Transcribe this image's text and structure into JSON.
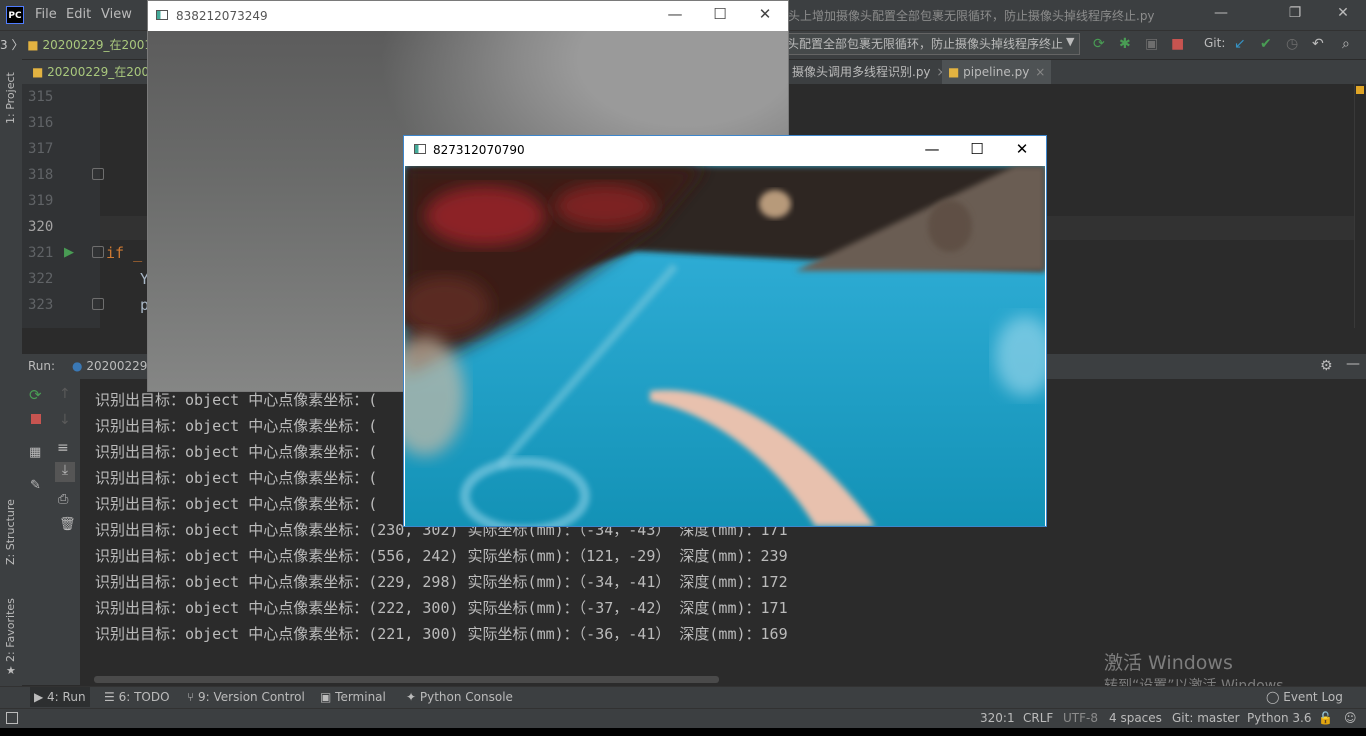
{
  "ide": {
    "logo": "PC",
    "menu": [
      "File",
      "Edit",
      "View"
    ],
    "title_fragment": "头上增加摄像头配置全部包裹无限循环，防止摄像头掉线程序终止.py",
    "minimize": "—",
    "maximize": "❐",
    "close": "✕"
  },
  "toolbar": {
    "project_crumb_left": "3 〉",
    "project_crumb": "20200229_在20010",
    "run_config": "头配置全部包裹无限循环，防止摄像头掉线程序终止",
    "git_label": "Git:"
  },
  "tabs": [
    {
      "label": "20200229_在200"
    },
    {
      "label": "摄像头调用多线程识别.py"
    },
    {
      "label": "pipeline.py"
    }
  ],
  "side_tabs": {
    "project": "1: Project",
    "structure": "Z: Structure",
    "favorites": "2: Favorites"
  },
  "editor": {
    "line_numbers": [
      "315",
      "316",
      "317",
      "318",
      "319",
      "320",
      "321",
      "322",
      "323"
    ],
    "code_if": "if _",
    "code_y": "Y",
    "code_p": "p"
  },
  "run": {
    "label": "Run:",
    "config": "20200229"
  },
  "console_lines": [
    "识别出目标：object 中心点像素坐标：(",
    "识别出目标：object 中心点像素坐标：(",
    "识别出目标：object 中心点像素坐标：(",
    "识别出目标：object 中心点像素坐标：(",
    "识别出目标：object 中心点像素坐标：(",
    "识别出目标：object 中心点像素坐标：(230, 302) 实际坐标(mm)：（-34，-43） 深度(mm)：171",
    "识别出目标：object 中心点像素坐标：(556, 242) 实际坐标(mm)：（121，-29） 深度(mm)：239",
    "识别出目标：object 中心点像素坐标：(229, 298) 实际坐标(mm)：（-34，-41） 深度(mm)：172",
    "识别出目标：object 中心点像素坐标：(222, 300) 实际坐标(mm)：（-37，-42） 深度(mm)：171",
    "识别出目标：object 中心点像素坐标：(221, 300) 实际坐标(mm)：（-36，-41） 深度(mm)：169"
  ],
  "bottom_tabs": [
    {
      "label": "4: Run"
    },
    {
      "label": "6: TODO"
    },
    {
      "label": "9: Version Control"
    },
    {
      "label": "Terminal"
    },
    {
      "label": "Python Console"
    }
  ],
  "event_log": "Event Log",
  "status": {
    "position": "320:1",
    "line_sep": "CRLF",
    "encoding": "UTF-8",
    "indent": "4 spaces",
    "branch": "Git: master",
    "interpreter": "Python 3.6"
  },
  "watermark": {
    "line1": "激活 Windows",
    "line2": "转到“设置”以激活 Windows。"
  },
  "camera_window_1": {
    "title": "838212073249",
    "minimize": "—",
    "maximize": "☐",
    "close": "✕"
  },
  "camera_window_2": {
    "title": "827312070790",
    "minimize": "—",
    "maximize": "☐",
    "close": "✕"
  },
  "colors": {
    "ide_bg": "#2b2b2b",
    "panel": "#3c3f41",
    "accent_run_green": "#499c54",
    "camera_cyan": "#1fa3c6"
  }
}
